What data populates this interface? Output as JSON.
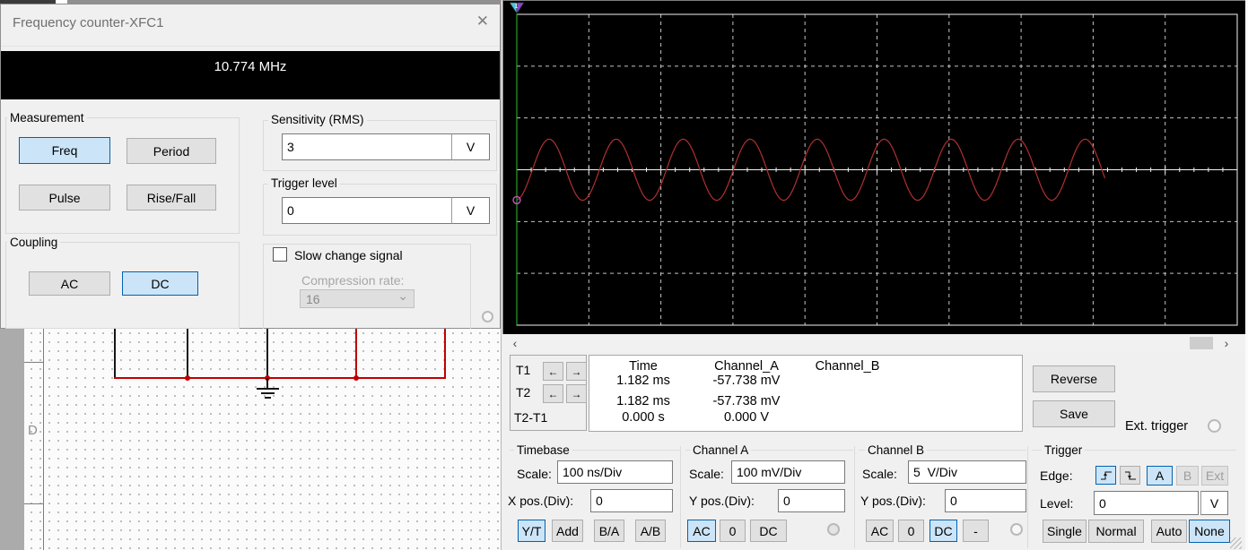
{
  "icons": {
    "close": "✕",
    "scroll_left": "‹",
    "scroll_right": "›",
    "arrow_left": "←",
    "arrow_right": "→",
    "chevron_down": "⌄"
  },
  "frequency_counter": {
    "title": "Frequency counter-XFC1",
    "display_value": "10.774 MHz",
    "measurement": {
      "label": "Measurement",
      "freq": "Freq",
      "period": "Period",
      "pulse": "Pulse",
      "rise_fall": "Rise/Fall"
    },
    "coupling": {
      "label": "Coupling",
      "ac": "AC",
      "dc": "DC"
    },
    "sensitivity": {
      "label": "Sensitivity (RMS)",
      "value": "3",
      "unit": "V"
    },
    "trigger_level": {
      "label": "Trigger level",
      "value": "0",
      "unit": "V"
    },
    "slow_change": {
      "label": "Slow change signal",
      "checked": false,
      "compression_label": "Compression rate:",
      "compression_value": "16"
    }
  },
  "oscilloscope": {
    "cursors_panel": {
      "t1": "T1",
      "t2": "T2",
      "dt": "T2-T1"
    },
    "readout": {
      "columns": [
        "Time",
        "Channel_A",
        "Channel_B"
      ],
      "rows": [
        [
          "1.182 ms",
          "-57.738 mV",
          ""
        ],
        [
          "1.182 ms",
          "-57.738 mV",
          ""
        ],
        [
          "0.000 s",
          "0.000 V",
          ""
        ]
      ]
    },
    "reverse": "Reverse",
    "save": "Save",
    "ext_trigger": "Ext. trigger",
    "timebase": {
      "label": "Timebase",
      "scale_label": "Scale:",
      "scale": "100 ns/Div",
      "pos_label": "X pos.(Div):",
      "pos": "0",
      "yt": "Y/T",
      "add": "Add",
      "ba": "B/A",
      "ab": "A/B"
    },
    "channel_a": {
      "label": "Channel A",
      "scale_label": "Scale:",
      "scale": "100 mV/Div",
      "pos_label": "Y pos.(Div):",
      "pos": "0",
      "ac": "AC",
      "zero": "0",
      "dc": "DC"
    },
    "channel_b": {
      "label": "Channel B",
      "scale_label": "Scale:",
      "scale": "5  V/Div",
      "pos_label": "Y pos.(Div):",
      "pos": "0",
      "ac": "AC",
      "zero": "0",
      "dc": "DC",
      "minus": "-"
    },
    "trigger": {
      "label": "Trigger",
      "edge_label": "Edge:",
      "a": "A",
      "b": "B",
      "ext": "Ext",
      "level_label": "Level:",
      "level": "0",
      "level_unit": "V",
      "single": "Single",
      "normal": "Normal",
      "auto": "Auto",
      "none": "None"
    }
  },
  "circuit": {
    "row_label": "D"
  },
  "chart_data": {
    "type": "line",
    "title": "Oscilloscope display",
    "x_axis": {
      "divisions": 10,
      "scale": "100 ns/Div",
      "position_div": 0
    },
    "y_axis": {
      "divisions": 6,
      "channel_a_scale": "100 mV/Div",
      "channel_b_scale": "5 V/Div",
      "position_div": 0
    },
    "grid": "dashed",
    "grid_color": "#c4c4c4",
    "frame_color": "#f2f2f2",
    "series": [
      {
        "name": "Channel A",
        "shape": "sine",
        "color": "#b03030",
        "amplitude_div": 0.59,
        "amplitude_mv": 59,
        "period_div": 0.93,
        "start_phase_deg": 6,
        "x_end_frac": 0.818
      }
    ],
    "cursors": [
      {
        "id": "1",
        "x_frac": 0,
        "time": "1.182 ms",
        "channel_a": "-57.738 mV",
        "line_color": "#2ec22e",
        "marker_color": "#c155c1",
        "flag_left_color": "#49c8dc",
        "flag_right_color": "#8a46cc"
      }
    ]
  }
}
